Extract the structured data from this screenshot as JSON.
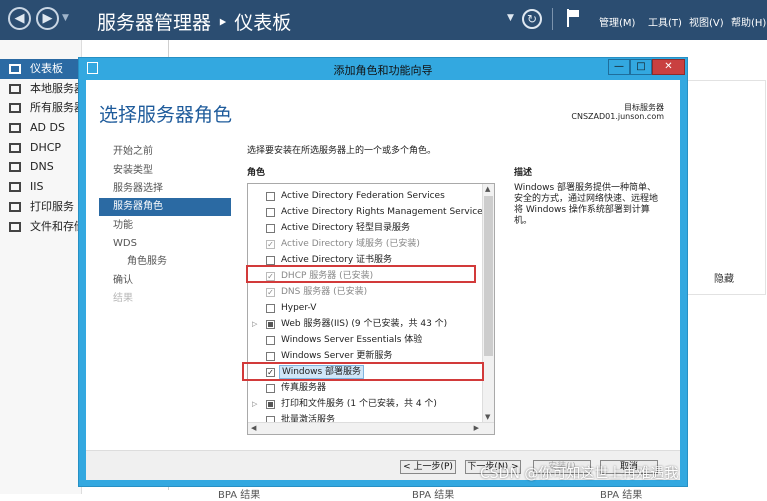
{
  "header": {
    "title": "服务器管理器 ‣ 仪表板",
    "menus": [
      "管理(M)",
      "工具(T)",
      "视图(V)",
      "帮助(H)"
    ],
    "icons": {
      "back": "back-arrow-icon",
      "forward": "forward-arrow-icon",
      "refresh": "refresh-icon",
      "notifications": "flag-icon"
    }
  },
  "nav": {
    "items": [
      {
        "label": "仪表板",
        "active": true
      },
      {
        "label": "本地服务器"
      },
      {
        "label": "所有服务器"
      },
      {
        "label": "AD DS"
      },
      {
        "label": "DHCP"
      },
      {
        "label": "DNS"
      },
      {
        "label": "IIS"
      },
      {
        "label": "打印服务"
      },
      {
        "label": "文件和存储服务"
      }
    ]
  },
  "background": {
    "hide_label": "隐藏",
    "bpa_labels": [
      "BPA 结果",
      "BPA 结果",
      "BPA 结果"
    ]
  },
  "wizard": {
    "window_title": "添加角色和功能向导",
    "window_buttons": {
      "min": "—",
      "max": "□",
      "close": "✕"
    },
    "page_title": "选择服务器角色",
    "target_label": "目标服务器",
    "target_server": "CNSZAD01.junson.com",
    "steps": [
      {
        "label": "开始之前"
      },
      {
        "label": "安装类型"
      },
      {
        "label": "服务器选择"
      },
      {
        "label": "服务器角色",
        "active": true
      },
      {
        "label": "功能"
      },
      {
        "label": "WDS"
      },
      {
        "label": "角色服务",
        "sub": true
      },
      {
        "label": "确认"
      },
      {
        "label": "结果",
        "disabled": true
      }
    ],
    "instruction": "选择要安装在所选服务器上的一个或多个角色。",
    "roles_heading": "角色",
    "roles": [
      {
        "label": "Active Directory Federation Services",
        "state": "unchecked"
      },
      {
        "label": "Active Directory Rights Management Services",
        "state": "unchecked"
      },
      {
        "label": "Active Directory 轻型目录服务",
        "state": "unchecked"
      },
      {
        "label": "Active Directory 域服务 (已安装)",
        "state": "installed"
      },
      {
        "label": "Active Directory 证书服务",
        "state": "unchecked"
      },
      {
        "label": "DHCP 服务器 (已安装)",
        "state": "installed"
      },
      {
        "label": "DNS 服务器 (已安装)",
        "state": "installed"
      },
      {
        "label": "Hyper-V",
        "state": "unchecked"
      },
      {
        "label": "Web 服务器(IIS) (9 个已安装，共 43 个)",
        "state": "partial",
        "expandable": true
      },
      {
        "label": "Windows Server Essentials 体验",
        "state": "unchecked"
      },
      {
        "label": "Windows Server 更新服务",
        "state": "unchecked"
      },
      {
        "label": "Windows 部署服务",
        "state": "checked",
        "selected": true
      },
      {
        "label": "传真服务器",
        "state": "unchecked"
      },
      {
        "label": "打印和文件服务 (1 个已安装，共 4 个)",
        "state": "partial",
        "expandable": true
      },
      {
        "label": "批量激活服务",
        "state": "unchecked"
      }
    ],
    "description_heading": "描述",
    "description": "Windows 部署服务提供一种简单、安全的方式，通过网络快速、远程地将 Windows 操作系统部署到计算机。",
    "footer": {
      "previous": "< 上一步(P)",
      "next": "下一步(N) >",
      "install": "安装(I)",
      "cancel": "取消"
    }
  },
  "watermark": "CSDN @你可知这世上再难遇我"
}
